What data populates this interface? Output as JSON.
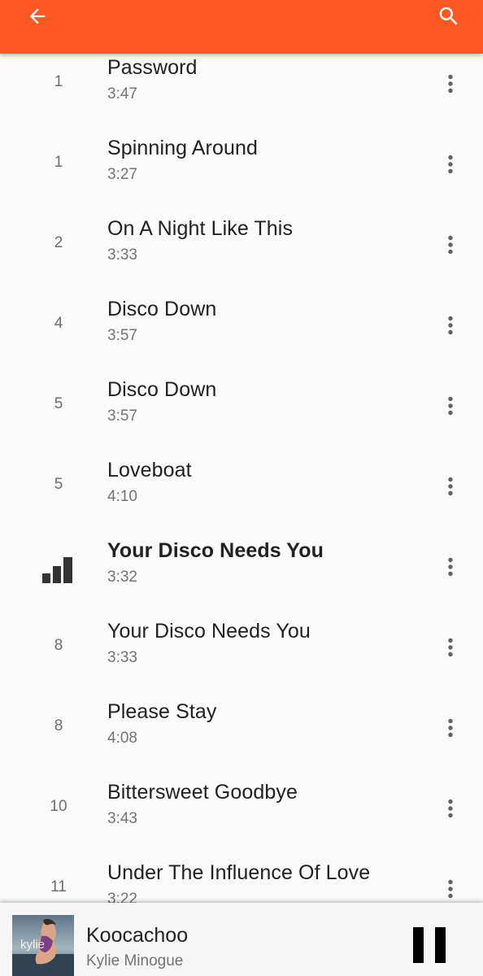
{
  "colors": {
    "accent": "#ff5722",
    "background": "#fafafa",
    "text_primary": "#212121",
    "text_secondary": "#737373",
    "player_background": "#f6f6f6"
  },
  "appbar": {
    "back_icon": "arrow-back-icon",
    "search_icon": "search-icon"
  },
  "tracks": [
    {
      "number": "1",
      "title": "Password",
      "duration": "3:47"
    },
    {
      "number": "1",
      "title": "Spinning Around",
      "duration": "3:27"
    },
    {
      "number": "2",
      "title": "On A Night Like This",
      "duration": "3:33"
    },
    {
      "number": "4",
      "title": "Disco Down",
      "duration": "3:57"
    },
    {
      "number": "5",
      "title": "Disco Down",
      "duration": "3:57"
    },
    {
      "number": "5",
      "title": "Loveboat",
      "duration": "4:10"
    },
    {
      "number": "",
      "title": "Your Disco Needs You",
      "duration": "3:32",
      "now_playing": true,
      "indicator_icon": "equalizer-bars-icon"
    },
    {
      "number": "8",
      "title": "Your Disco Needs You",
      "duration": "3:33"
    },
    {
      "number": "8",
      "title": "Please Stay",
      "duration": "4:08"
    },
    {
      "number": "10",
      "title": "Bittersweet Goodbye",
      "duration": "3:43"
    },
    {
      "number": "11",
      "title": "Under The Influence Of Love",
      "duration": "3:22"
    }
  ],
  "track_menu_icon": "more-vert-icon",
  "player": {
    "title": "Koocachoo",
    "artist": "Kylie Minogue",
    "album_art_text": "kylie",
    "control_icon": "pause-icon"
  }
}
